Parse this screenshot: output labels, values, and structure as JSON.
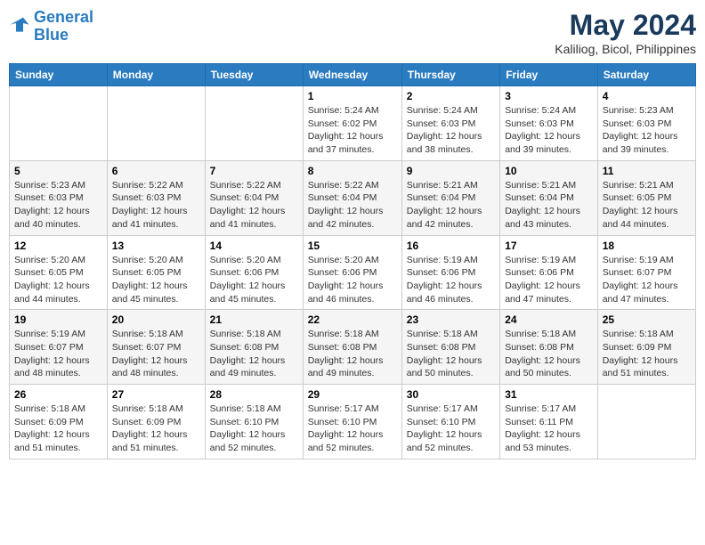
{
  "logo": {
    "line1": "General",
    "line2": "Blue"
  },
  "title": "May 2024",
  "location": "Kaliliog, Bicol, Philippines",
  "weekdays": [
    "Sunday",
    "Monday",
    "Tuesday",
    "Wednesday",
    "Thursday",
    "Friday",
    "Saturday"
  ],
  "weeks": [
    [
      {
        "day": "",
        "info": ""
      },
      {
        "day": "",
        "info": ""
      },
      {
        "day": "",
        "info": ""
      },
      {
        "day": "1",
        "info": "Sunrise: 5:24 AM\nSunset: 6:02 PM\nDaylight: 12 hours\nand 37 minutes."
      },
      {
        "day": "2",
        "info": "Sunrise: 5:24 AM\nSunset: 6:03 PM\nDaylight: 12 hours\nand 38 minutes."
      },
      {
        "day": "3",
        "info": "Sunrise: 5:24 AM\nSunset: 6:03 PM\nDaylight: 12 hours\nand 39 minutes."
      },
      {
        "day": "4",
        "info": "Sunrise: 5:23 AM\nSunset: 6:03 PM\nDaylight: 12 hours\nand 39 minutes."
      }
    ],
    [
      {
        "day": "5",
        "info": "Sunrise: 5:23 AM\nSunset: 6:03 PM\nDaylight: 12 hours\nand 40 minutes."
      },
      {
        "day": "6",
        "info": "Sunrise: 5:22 AM\nSunset: 6:03 PM\nDaylight: 12 hours\nand 41 minutes."
      },
      {
        "day": "7",
        "info": "Sunrise: 5:22 AM\nSunset: 6:04 PM\nDaylight: 12 hours\nand 41 minutes."
      },
      {
        "day": "8",
        "info": "Sunrise: 5:22 AM\nSunset: 6:04 PM\nDaylight: 12 hours\nand 42 minutes."
      },
      {
        "day": "9",
        "info": "Sunrise: 5:21 AM\nSunset: 6:04 PM\nDaylight: 12 hours\nand 42 minutes."
      },
      {
        "day": "10",
        "info": "Sunrise: 5:21 AM\nSunset: 6:04 PM\nDaylight: 12 hours\nand 43 minutes."
      },
      {
        "day": "11",
        "info": "Sunrise: 5:21 AM\nSunset: 6:05 PM\nDaylight: 12 hours\nand 44 minutes."
      }
    ],
    [
      {
        "day": "12",
        "info": "Sunrise: 5:20 AM\nSunset: 6:05 PM\nDaylight: 12 hours\nand 44 minutes."
      },
      {
        "day": "13",
        "info": "Sunrise: 5:20 AM\nSunset: 6:05 PM\nDaylight: 12 hours\nand 45 minutes."
      },
      {
        "day": "14",
        "info": "Sunrise: 5:20 AM\nSunset: 6:06 PM\nDaylight: 12 hours\nand 45 minutes."
      },
      {
        "day": "15",
        "info": "Sunrise: 5:20 AM\nSunset: 6:06 PM\nDaylight: 12 hours\nand 46 minutes."
      },
      {
        "day": "16",
        "info": "Sunrise: 5:19 AM\nSunset: 6:06 PM\nDaylight: 12 hours\nand 46 minutes."
      },
      {
        "day": "17",
        "info": "Sunrise: 5:19 AM\nSunset: 6:06 PM\nDaylight: 12 hours\nand 47 minutes."
      },
      {
        "day": "18",
        "info": "Sunrise: 5:19 AM\nSunset: 6:07 PM\nDaylight: 12 hours\nand 47 minutes."
      }
    ],
    [
      {
        "day": "19",
        "info": "Sunrise: 5:19 AM\nSunset: 6:07 PM\nDaylight: 12 hours\nand 48 minutes."
      },
      {
        "day": "20",
        "info": "Sunrise: 5:18 AM\nSunset: 6:07 PM\nDaylight: 12 hours\nand 48 minutes."
      },
      {
        "day": "21",
        "info": "Sunrise: 5:18 AM\nSunset: 6:08 PM\nDaylight: 12 hours\nand 49 minutes."
      },
      {
        "day": "22",
        "info": "Sunrise: 5:18 AM\nSunset: 6:08 PM\nDaylight: 12 hours\nand 49 minutes."
      },
      {
        "day": "23",
        "info": "Sunrise: 5:18 AM\nSunset: 6:08 PM\nDaylight: 12 hours\nand 50 minutes."
      },
      {
        "day": "24",
        "info": "Sunrise: 5:18 AM\nSunset: 6:08 PM\nDaylight: 12 hours\nand 50 minutes."
      },
      {
        "day": "25",
        "info": "Sunrise: 5:18 AM\nSunset: 6:09 PM\nDaylight: 12 hours\nand 51 minutes."
      }
    ],
    [
      {
        "day": "26",
        "info": "Sunrise: 5:18 AM\nSunset: 6:09 PM\nDaylight: 12 hours\nand 51 minutes."
      },
      {
        "day": "27",
        "info": "Sunrise: 5:18 AM\nSunset: 6:09 PM\nDaylight: 12 hours\nand 51 minutes."
      },
      {
        "day": "28",
        "info": "Sunrise: 5:18 AM\nSunset: 6:10 PM\nDaylight: 12 hours\nand 52 minutes."
      },
      {
        "day": "29",
        "info": "Sunrise: 5:17 AM\nSunset: 6:10 PM\nDaylight: 12 hours\nand 52 minutes."
      },
      {
        "day": "30",
        "info": "Sunrise: 5:17 AM\nSunset: 6:10 PM\nDaylight: 12 hours\nand 52 minutes."
      },
      {
        "day": "31",
        "info": "Sunrise: 5:17 AM\nSunset: 6:11 PM\nDaylight: 12 hours\nand 53 minutes."
      },
      {
        "day": "",
        "info": ""
      }
    ]
  ]
}
